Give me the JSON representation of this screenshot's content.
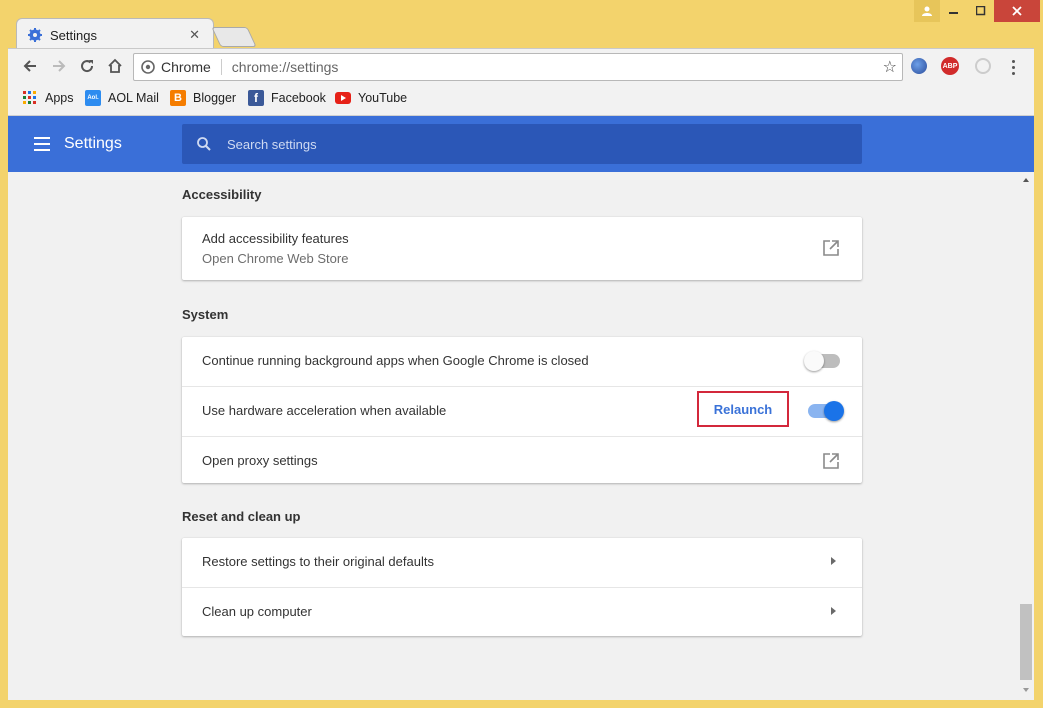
{
  "window": {
    "tab_title": "Settings",
    "controls": [
      "user-icon",
      "minimize-icon",
      "maximize-icon",
      "close-icon"
    ]
  },
  "omnibox": {
    "site_label": "Chrome",
    "url": "chrome://settings"
  },
  "bookmarks": [
    {
      "label": "Apps",
      "icon": "apps-grid-icon"
    },
    {
      "label": "AOL Mail",
      "icon": "aol-icon"
    },
    {
      "label": "Blogger",
      "icon": "blogger-icon"
    },
    {
      "label": "Facebook",
      "icon": "facebook-icon"
    },
    {
      "label": "YouTube",
      "icon": "youtube-icon"
    }
  ],
  "header": {
    "title": "Settings",
    "search_placeholder": "Search settings"
  },
  "sections": {
    "accessibility": {
      "title": "Accessibility",
      "item_label": "Add accessibility features",
      "item_sub": "Open Chrome Web Store"
    },
    "system": {
      "title": "System",
      "background_apps": "Continue running background apps when Google Chrome is closed",
      "background_apps_on": false,
      "hardware_accel": "Use hardware acceleration when available",
      "hardware_accel_on": true,
      "relaunch_label": "Relaunch",
      "proxy": "Open proxy settings"
    },
    "reset": {
      "title": "Reset and clean up",
      "restore": "Restore settings to their original defaults",
      "cleanup": "Clean up computer"
    }
  },
  "colors": {
    "header_blue": "#3a6fd8",
    "search_blue": "#2b57b7",
    "toggle_on": "#1a73e8",
    "highlight_red": "#d3283b",
    "frame_yellow": "#f3d36c"
  },
  "abp_badge": "ABP"
}
